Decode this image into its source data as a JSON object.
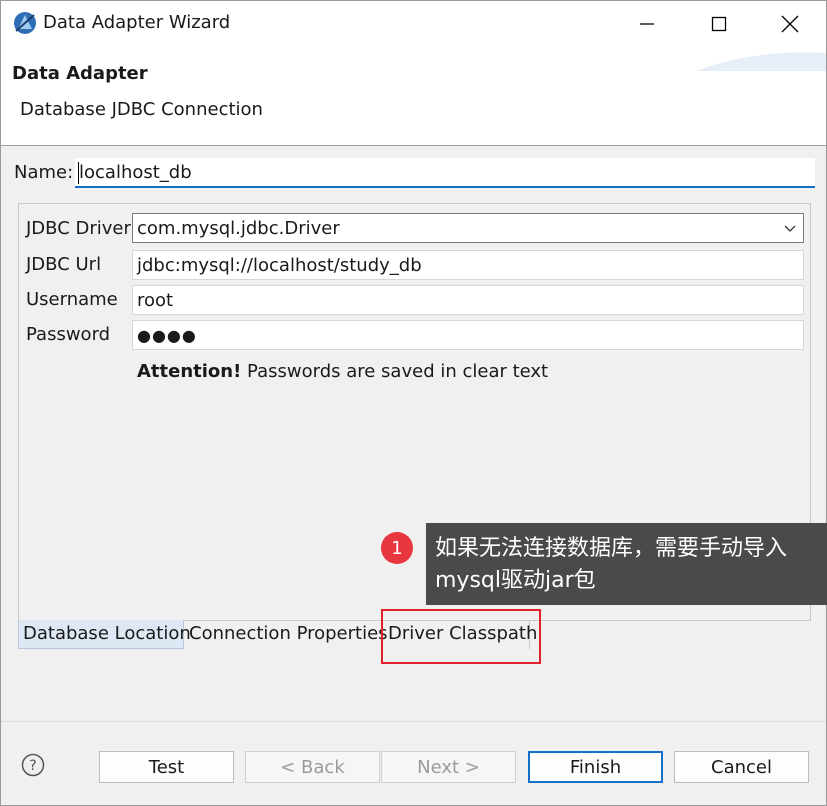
{
  "window": {
    "title": "Data Adapter Wizard"
  },
  "header": {
    "title": "Data Adapter",
    "subtitle": "Database JDBC Connection"
  },
  "name_field": {
    "label": "Name:",
    "value": "localhost_db"
  },
  "form": {
    "driver_label": "JDBC Driver",
    "driver_value": "com.mysql.jdbc.Driver",
    "url_label": "JDBC Url",
    "url_value": "jdbc:mysql://localhost/study_db",
    "username_label": "Username",
    "username_value": "root",
    "password_label": "Password",
    "password_value": "●●●●",
    "attention_bold": "Attention!",
    "attention_text": " Passwords are saved in clear text"
  },
  "tabs": [
    {
      "label": "Database Location",
      "active": true
    },
    {
      "label": "Connection Properties",
      "active": false
    },
    {
      "label": "Driver Classpath",
      "active": false
    }
  ],
  "annotation": {
    "number": "1",
    "line1": "如果无法连接数据库，需要手动导入",
    "line2": "mysql驱动jar包"
  },
  "buttons": {
    "test": "Test",
    "back": "< Back",
    "next": "Next >",
    "finish": "Finish",
    "cancel": "Cancel"
  },
  "colors": {
    "accent": "#1570c8",
    "highlight": "#e0202a",
    "badge": "#e8363e",
    "callout_bg": "#4a4a4a"
  }
}
